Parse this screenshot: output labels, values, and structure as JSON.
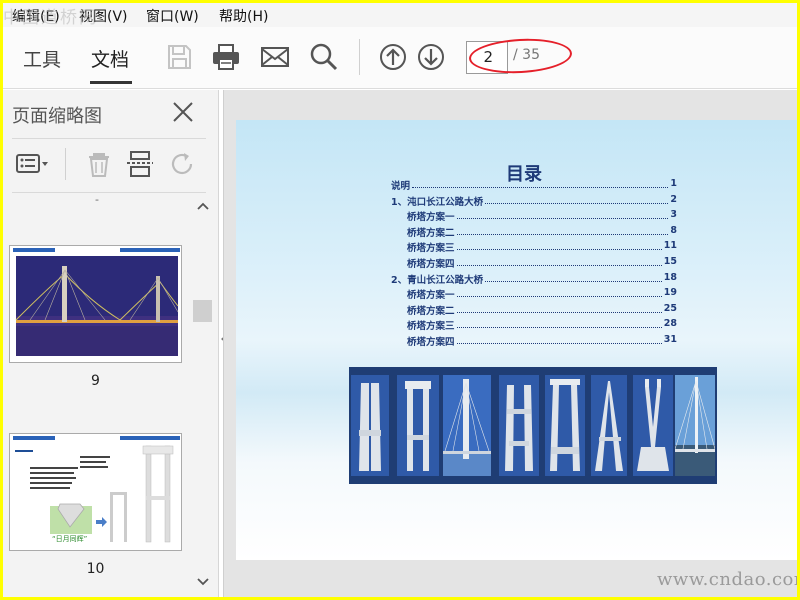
{
  "menubar": {
    "items": [
      "编辑(E)",
      "视图(V)",
      "窗口(W)",
      "帮助(H)"
    ],
    "watermark": "中国道桥网"
  },
  "toolbar": {
    "tabs": [
      "工具",
      "文档"
    ],
    "active_tab": "文档",
    "icons": [
      "save-icon",
      "print-icon",
      "mail-icon",
      "search-icon",
      "page-up-icon",
      "page-down-icon"
    ],
    "page_number": "2",
    "page_total": "/ 35",
    "annotation_color": "#e5202a"
  },
  "sidebar": {
    "title": "页面缩略图",
    "tools": [
      "options-icon",
      "delete-icon",
      "extract-icon",
      "rotate-icon"
    ],
    "thumbnails": [
      {
        "label": "9"
      },
      {
        "label": "10",
        "caption": "“日月同辉”"
      }
    ]
  },
  "document": {
    "title": "目录",
    "toc": [
      {
        "text": "说明",
        "page": "1",
        "indent": false
      },
      {
        "text": "1、沌口长江公路大桥",
        "page": "2",
        "indent": false
      },
      {
        "text": "桥塔方案一",
        "page": "3",
        "indent": true
      },
      {
        "text": "桥塔方案二",
        "page": "8",
        "indent": true
      },
      {
        "text": "桥塔方案三",
        "page": "11",
        "indent": true
      },
      {
        "text": "桥塔方案四",
        "page": "15",
        "indent": true
      },
      {
        "text": "2、青山长江公路大桥",
        "page": "18",
        "indent": false
      },
      {
        "text": "桥塔方案一",
        "page": "19",
        "indent": true
      },
      {
        "text": "桥塔方案二",
        "page": "25",
        "indent": true
      },
      {
        "text": "桥塔方案三",
        "page": "28",
        "indent": true
      },
      {
        "text": "桥塔方案四",
        "page": "31",
        "indent": true
      }
    ],
    "accent_color": "#1e3a78"
  },
  "watermark_bottom": "www.cndao.com"
}
